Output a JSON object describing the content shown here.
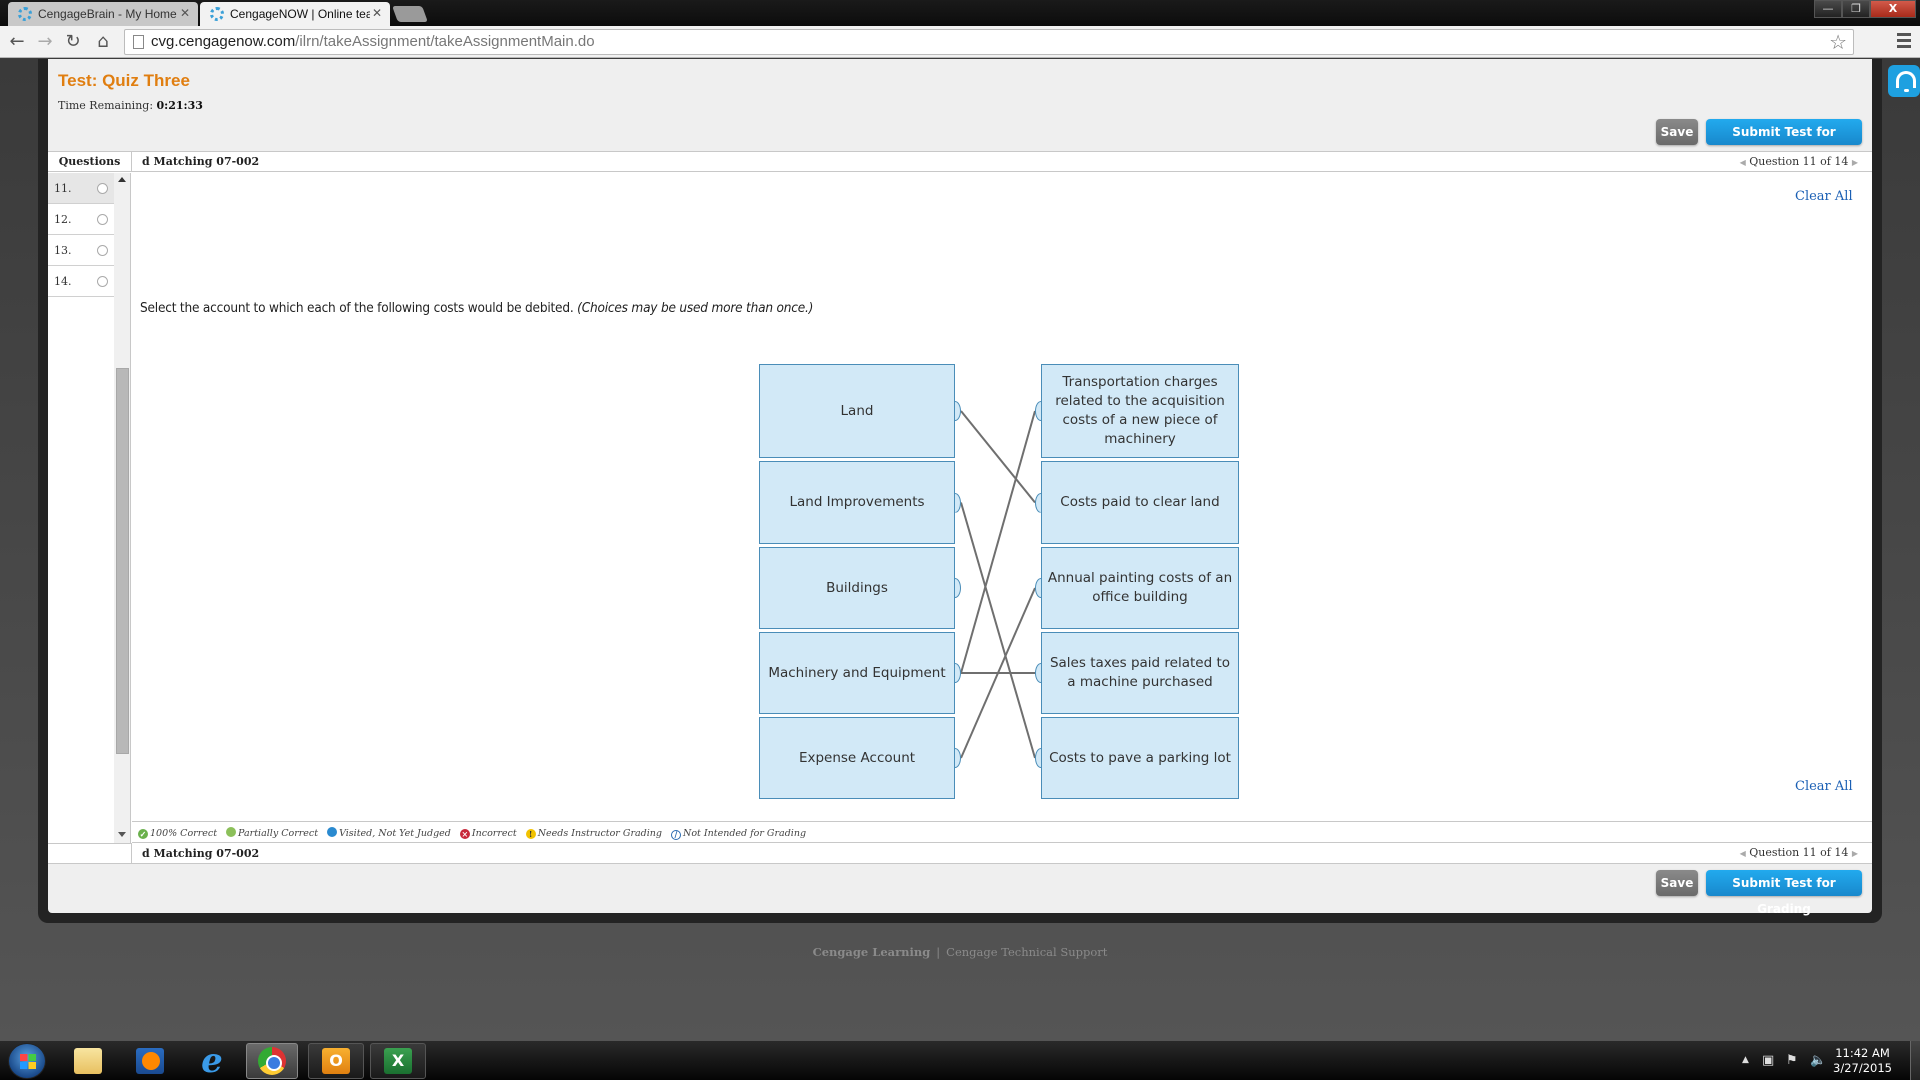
{
  "browser": {
    "tabs": [
      {
        "title": "CengageBrain - My Home",
        "active": false
      },
      {
        "title": "CengageNOW | Online tea",
        "active": true
      }
    ],
    "url_host": "cvg.cengagenow.com",
    "url_path": "/ilrn/takeAssignment/takeAssignmentMain.do",
    "window_buttons": {
      "minimize": "—",
      "restore": "❐",
      "close": "X"
    }
  },
  "header": {
    "test_title": "Test: Quiz Three",
    "time_label": "Time Remaining:",
    "time_value": "0:21:33"
  },
  "buttons": {
    "save": "Save",
    "submit": "Submit Test for Grading",
    "clear_all": "Clear All"
  },
  "questions_panel": {
    "header": "Questions",
    "items": [
      {
        "number": "11.",
        "current": true
      },
      {
        "number": "12.",
        "current": false
      },
      {
        "number": "13.",
        "current": false
      },
      {
        "number": "14.",
        "current": false
      }
    ]
  },
  "question": {
    "title": "d Matching 07-002",
    "nav_text": "Question 11 of 14",
    "prompt": "Select the account to which each of the following costs would be debited.",
    "prompt_note": "(Choices may be used more than once.)",
    "accounts": [
      "Land",
      "Land Improvements",
      "Buildings",
      "Machinery and Equipment",
      "Expense Account"
    ],
    "costs": [
      "Transportation charges related to the acquisition costs of a new piece of machinery",
      "Costs paid to clear land",
      "Annual painting costs of an office building",
      "Sales taxes paid related to a machine purchased",
      "Costs to pave a parking lot"
    ],
    "matches": [
      {
        "account": 0,
        "cost": 1
      },
      {
        "account": 1,
        "cost": 4
      },
      {
        "account": 3,
        "cost": 0
      },
      {
        "account": 3,
        "cost": 3
      },
      {
        "account": 4,
        "cost": 2
      }
    ]
  },
  "legend": [
    {
      "label": "100% Correct",
      "color": "#6ab04c",
      "glyph": "✓"
    },
    {
      "label": "Partially Correct",
      "color": "#8cc05a",
      "glyph": ""
    },
    {
      "label": "Visited, Not Yet Judged",
      "color": "#2a8ad0",
      "glyph": ""
    },
    {
      "label": "Incorrect",
      "color": "#c8283a",
      "glyph": "×"
    },
    {
      "label": "Needs Instructor Grading",
      "color": "#f2c200",
      "glyph": "!"
    },
    {
      "label": "Not Intended for Grading",
      "color": "#2a6ab0",
      "glyph": "⃠"
    }
  ],
  "footer": {
    "brand": "Cengage Learning",
    "separator": "|",
    "support": "Cengage Technical Support"
  },
  "taskbar": {
    "apps": [
      "Windows Explorer",
      "Windows Media Player",
      "Internet Explorer",
      "Google Chrome",
      "Microsoft Outlook",
      "Microsoft Excel"
    ],
    "time": "11:42 AM",
    "date": "3/27/2015"
  },
  "colors": {
    "title_orange": "#e07e10",
    "submit_blue": "#1a9ae0",
    "link_blue": "#1a5fb4",
    "match_box_fill": "#d2e9f7",
    "match_box_border": "#4a8db8"
  }
}
